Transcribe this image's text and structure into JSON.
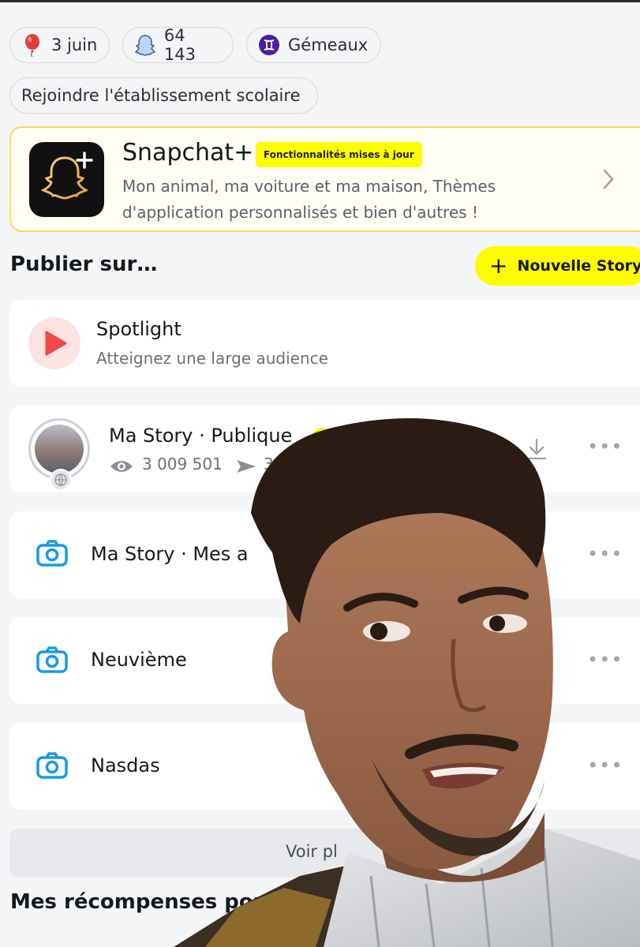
{
  "profile_chips": [
    {
      "label": "3 juin",
      "icon": "balloon-icon"
    },
    {
      "label": "64 143",
      "icon": "snapscore-icon"
    },
    {
      "label": "Gémeaux",
      "icon": "gemini-icon"
    },
    {
      "label": "Rejoindre l'établissement scolaire",
      "icon": ""
    }
  ],
  "snapchat_plus": {
    "title": "Snapchat+",
    "badge": "Fonctionnalités mises à jour",
    "description_line1": "Mon animal, ma voiture et ma maison, Thèmes",
    "description_line2": "d'application personnalisés et bien d'autres !"
  },
  "publish": {
    "title": "Publier sur…",
    "new_story_label": "Nouvelle Story"
  },
  "spotlight": {
    "name": "Spotlight",
    "subtitle": "Atteignez une large audience"
  },
  "public_story": {
    "name": "Ma Story · Publique",
    "views": "3 009 501",
    "shares": "335"
  },
  "stories": [
    {
      "name": "Ma Story · Mes a"
    },
    {
      "name": "Neuvième"
    },
    {
      "name": "Nasdas"
    }
  ],
  "see_more": "Voir pl",
  "rewards_title": "Mes récompenses pou",
  "colors": {
    "snap_yellow": "#fffc00",
    "accent_blue": "#1a9ae0",
    "spotlight_red": "#f04747"
  }
}
